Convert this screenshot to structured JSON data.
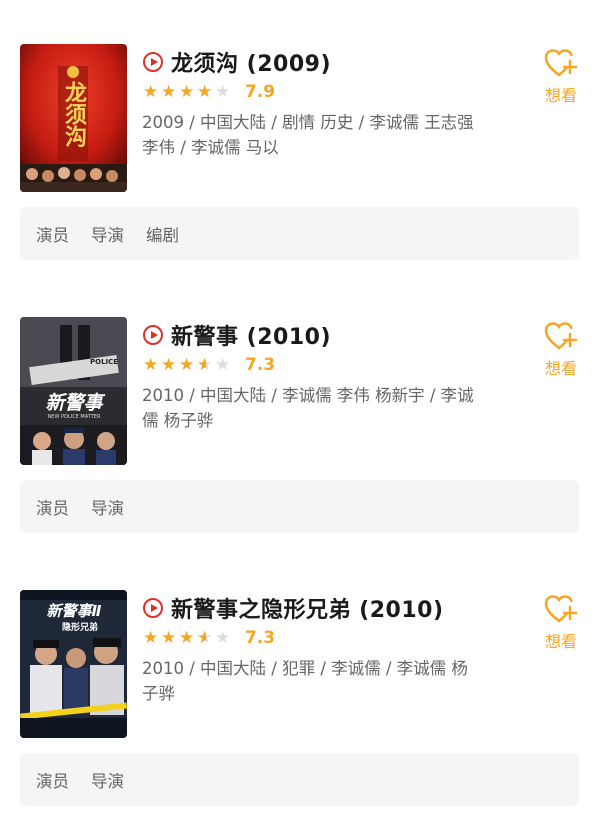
{
  "movies": [
    {
      "title": "龙须沟 (2009)",
      "stars": [
        "full",
        "full",
        "full",
        "full",
        "empty"
      ],
      "score": "7.9",
      "meta": "2009 / 中国大陆 / 剧情 历史 / 李诚儒 王志强 李伟 / 李诚儒 马以",
      "want": "想看",
      "tabs": [
        "演员",
        "导演",
        "编剧"
      ],
      "poster_title": "龙须沟"
    },
    {
      "title": "新警事 (2010)",
      "stars": [
        "full",
        "full",
        "full",
        "half",
        "empty"
      ],
      "score": "7.3",
      "meta": "2010 / 中国大陆 / 李诚儒 李伟 杨新宇 / 李诚儒 杨子骅",
      "want": "想看",
      "tabs": [
        "演员",
        "导演"
      ],
      "poster_title": "新警事",
      "poster_sub": "NEW POLICE MATTER",
      "poster_tag": "POLICE"
    },
    {
      "title": "新警事之隐形兄弟 (2010)",
      "stars": [
        "full",
        "full",
        "full",
        "half",
        "empty"
      ],
      "score": "7.3",
      "meta": "2010 / 中国大陆 / 犯罪 / 李诚儒 / 李诚儒 杨子骅",
      "want": "想看",
      "tabs": [
        "演员",
        "导演"
      ],
      "poster_title": "新警事Ⅱ",
      "poster_sub": "隐形兄弟"
    }
  ],
  "colors": {
    "accent": "#f5a623",
    "play": "#e0302a",
    "meta": "#666666",
    "tabs_bg": "#f5f5f5"
  }
}
